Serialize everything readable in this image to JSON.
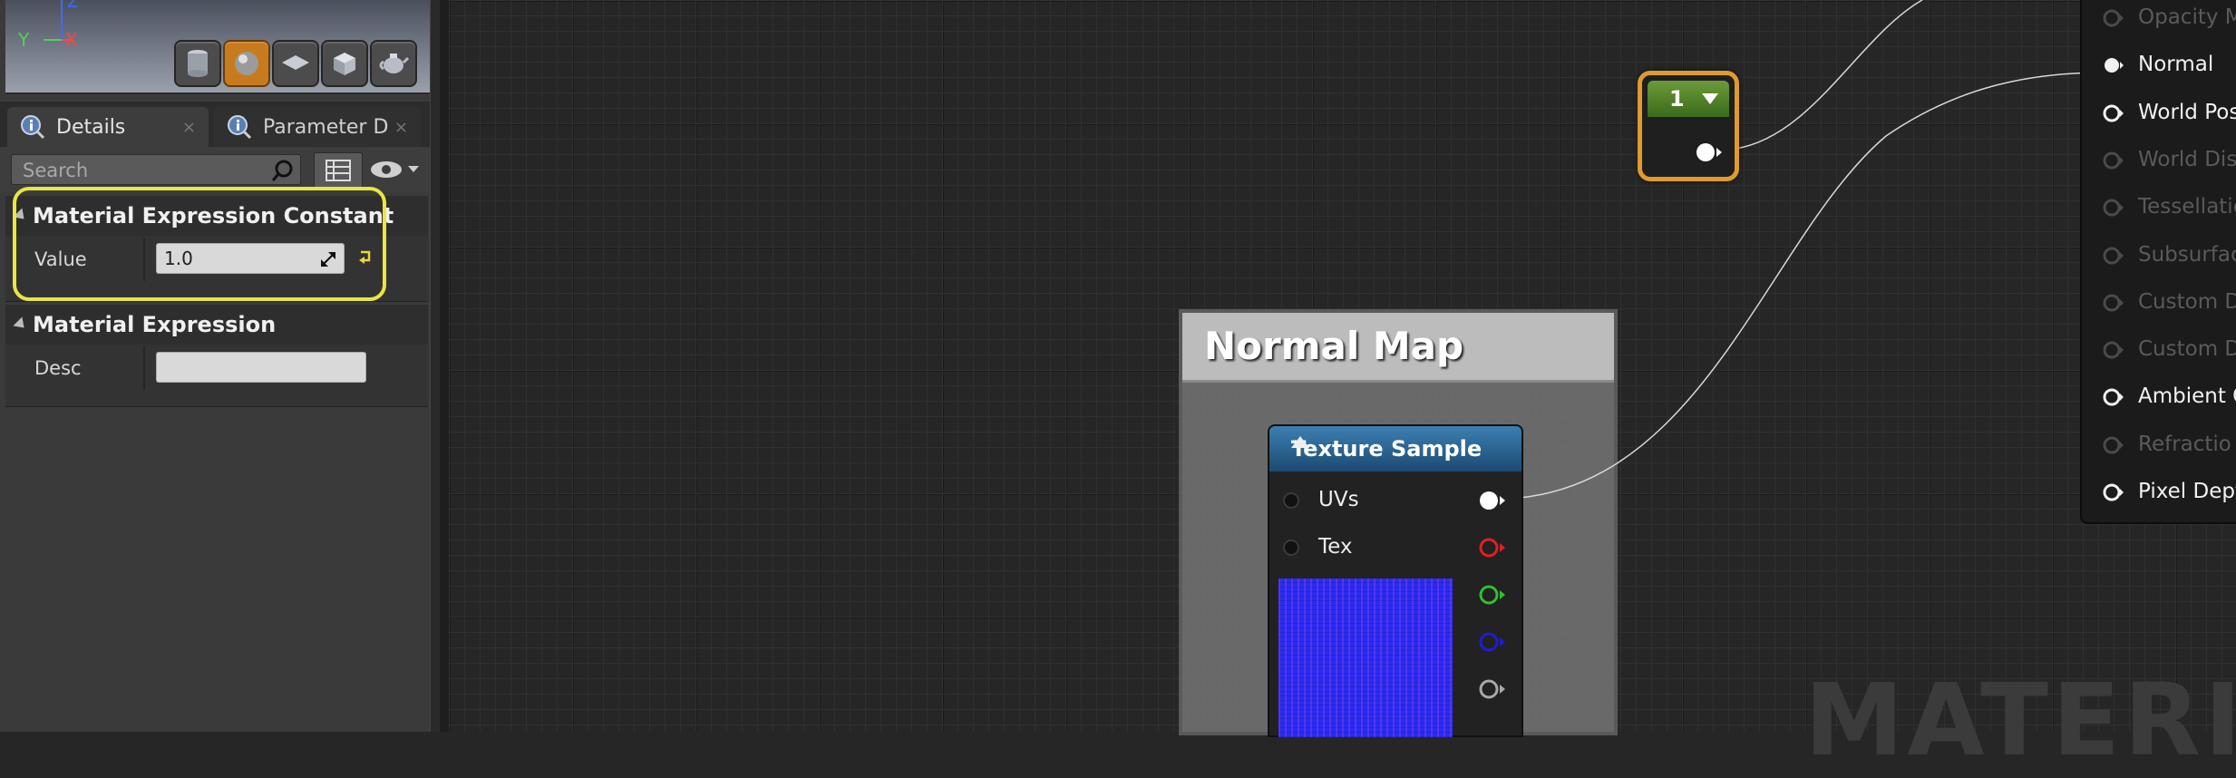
{
  "viewport": {
    "axis_x": "X",
    "axis_y": "Y",
    "axis_z": "Z",
    "preview_buttons": [
      "cylinder-preview",
      "sphere-preview",
      "plane-preview",
      "cube-preview",
      "custom-mesh-preview"
    ],
    "active_button": "sphere-preview"
  },
  "tabs": [
    {
      "label": "Details",
      "active": true
    },
    {
      "label": "Parameter D",
      "active": false
    }
  ],
  "search": {
    "placeholder": "Search",
    "value": ""
  },
  "sections": [
    {
      "title": "Material Expression Constant",
      "properties": [
        {
          "label": "Value",
          "value": "1.0"
        }
      ]
    },
    {
      "title": "Material Expression",
      "properties": [
        {
          "label": "Desc",
          "value": ""
        }
      ]
    }
  ],
  "graph": {
    "constant_node": {
      "value": "1"
    },
    "comment": {
      "title": "Normal Map"
    },
    "texture_sample": {
      "title": "Texture Sample",
      "inputs": [
        "UVs",
        "Tex"
      ],
      "outputs": [
        "rgb",
        "r",
        "g",
        "b",
        "a"
      ]
    },
    "material_inputs": [
      {
        "label": "Opacity M",
        "enabled": false
      },
      {
        "label": "Normal",
        "enabled": true
      },
      {
        "label": "World Pos",
        "enabled": true
      },
      {
        "label": "World Disp",
        "enabled": false
      },
      {
        "label": "Tessellatio",
        "enabled": false
      },
      {
        "label": "Subsurfac",
        "enabled": false
      },
      {
        "label": "Custom Da",
        "enabled": false
      },
      {
        "label": "Custom Da",
        "enabled": false
      },
      {
        "label": "Ambient O",
        "enabled": true
      },
      {
        "label": "Refractio",
        "enabled": false
      },
      {
        "label": "Pixel Dept",
        "enabled": true
      }
    ],
    "watermark": "MATERIAL"
  },
  "colors": {
    "highlight": "#e8e641",
    "constant_header": "#4f7f2a",
    "texture_header": "#2c6594",
    "selection_border": "#e09a2e"
  }
}
